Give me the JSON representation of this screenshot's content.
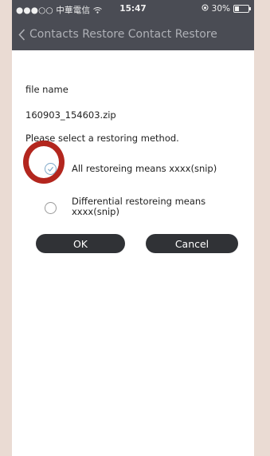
{
  "status_bar": {
    "carrier": "●●●○○ 中華電信 ",
    "time": "15:47",
    "battery_text": "30%"
  },
  "nav": {
    "title": "Contacts Restore Contact Restore"
  },
  "form": {
    "file_label": "file name",
    "file_value": "160903_154603.zip",
    "prompt": "Please select a restoring method.",
    "options": [
      {
        "label": "All restoreing means xxxx(snip)",
        "selected": true
      },
      {
        "label_line1": "Differential restoreing means",
        "label_line2": "xxxx(snip)",
        "selected": false
      }
    ]
  },
  "buttons": {
    "ok": "OK",
    "cancel": "Cancel"
  },
  "colors": {
    "header_bg": "#4a4c54",
    "button_bg": "#303236",
    "annotation_circle": "#b3261e",
    "radio_check": "#7fa9c9"
  }
}
